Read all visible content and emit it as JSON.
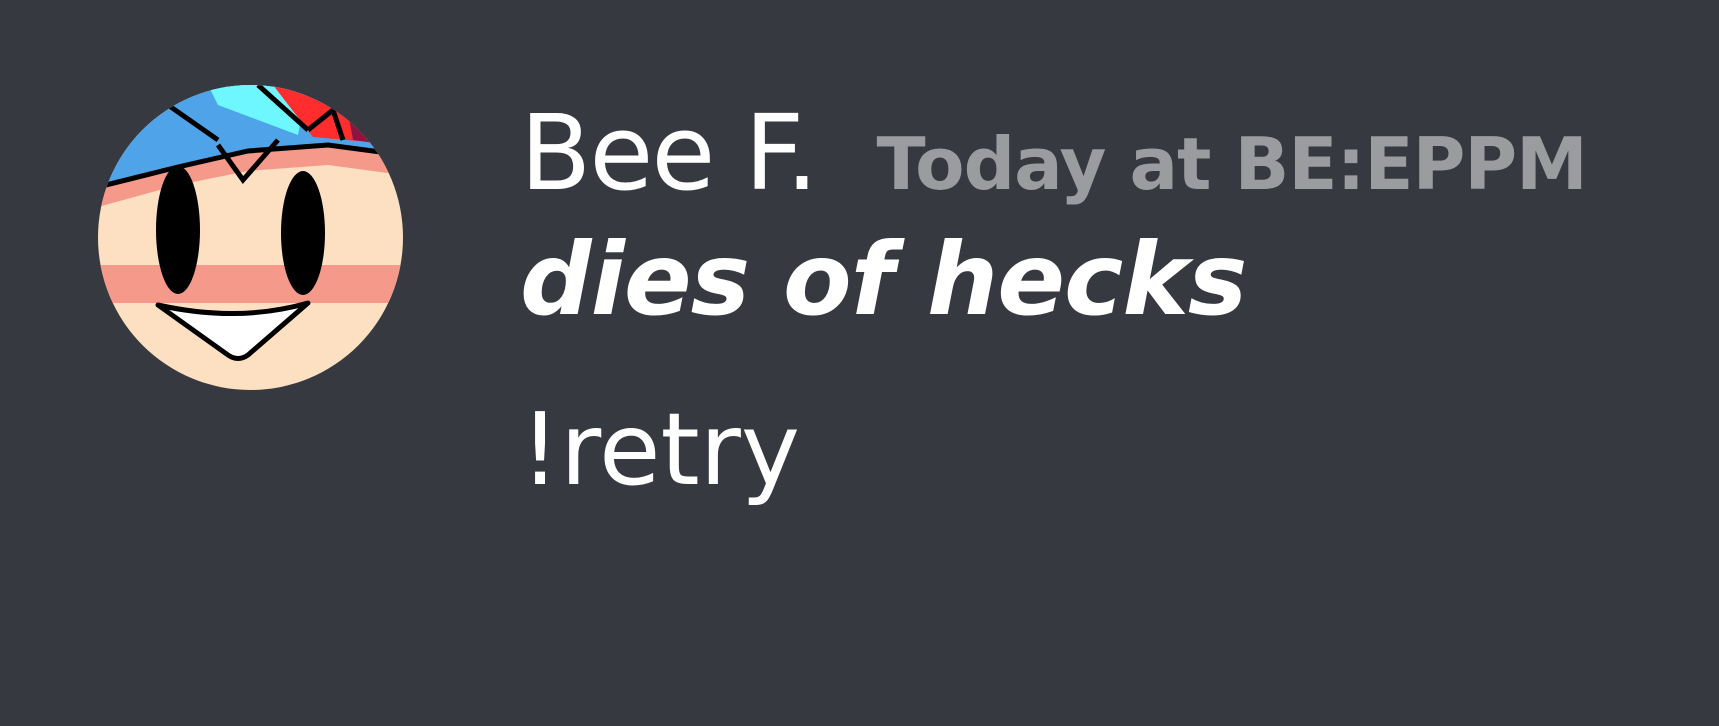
{
  "message": {
    "author": {
      "name": "Bee F.",
      "avatar_icon": "cartoon-face-avatar-icon"
    },
    "timestamp": "Today at BE:EPPM",
    "lines": [
      "dies of hecks",
      "!retry"
    ]
  },
  "colors": {
    "background": "#36393f",
    "username": "#ffffff",
    "timestamp": "#9a9ca0",
    "message_text": "#ffffff",
    "skin": "#fde0c2",
    "blush": "#f5998a",
    "cap_blue": "#4fa3e8",
    "cap_cyan": "#6ff7ff",
    "cap_red": "#ff2d2d"
  }
}
